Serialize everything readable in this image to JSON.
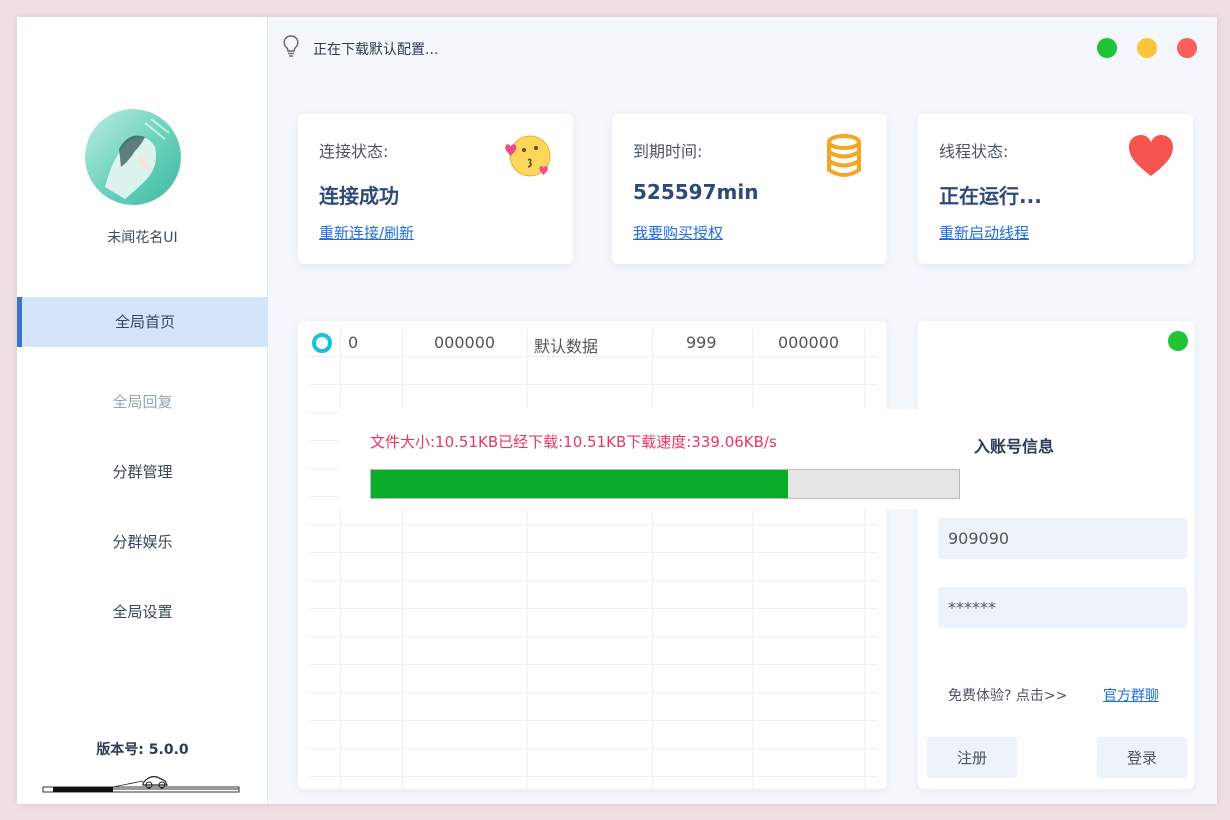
{
  "status": {
    "text": "正在下载默认配置..."
  },
  "window_controls": {
    "colors": {
      "green": "#1fc537",
      "yellow": "#fdc33a",
      "red": "#fa5f5a"
    }
  },
  "sidebar": {
    "username": "未闻花名UI",
    "items": [
      {
        "label": "全局首页",
        "active": true
      },
      {
        "label": "全局回复",
        "muted": true
      },
      {
        "label": "分群管理"
      },
      {
        "label": "分群娱乐"
      },
      {
        "label": "全局设置"
      }
    ],
    "version_label": "版本号:",
    "version_value": "5.0.0"
  },
  "cards": [
    {
      "label": "连接状态:",
      "value": "连接成功",
      "link": "重新连接/刷新",
      "icon": "kiss-emoji-icon"
    },
    {
      "label": "到期时间:",
      "value": "525597min",
      "link": "我要购买授权",
      "icon": "database-icon"
    },
    {
      "label": "线程状态:",
      "value": "正在运行...",
      "link": "重新启动线程",
      "icon": "heart-icon"
    }
  ],
  "table": {
    "row": [
      "0",
      "000000",
      "默认数据",
      "999",
      "000000"
    ]
  },
  "download": {
    "text": "文件大小:10.51KB已经下载:10.51KB下载速度:339.06KB/s",
    "progress": 0.71
  },
  "login": {
    "title": "入账号信息",
    "account_value": "909090",
    "password_value": "******",
    "trial_text": "免费体验? 点击>>",
    "group_link": "官方群聊",
    "register_label": "注册",
    "login_label": "登录",
    "status_color": "#1fc537"
  },
  "colors": {
    "accent": "#3d73c9",
    "link": "#1e6ddc",
    "progress": "#0aad2a",
    "download_text": "#e8385f"
  }
}
